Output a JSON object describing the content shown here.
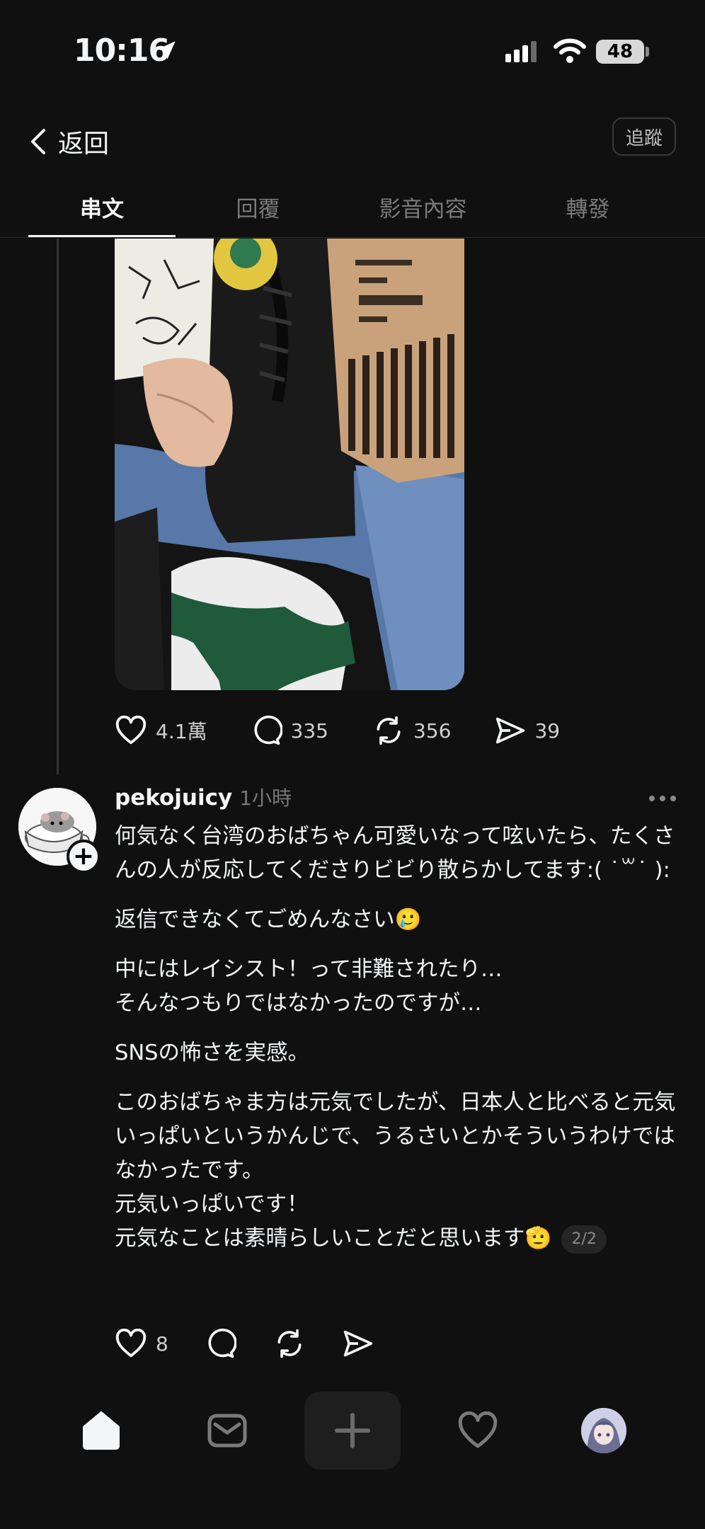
{
  "status_bar": {
    "time": "10:16",
    "battery": "48"
  },
  "header": {
    "back_label": "返回",
    "follow_label": "追蹤"
  },
  "tabs": [
    {
      "label": "串文",
      "active": true
    },
    {
      "label": "回覆"
    },
    {
      "label": "影音內容"
    },
    {
      "label": "轉發"
    }
  ],
  "main_post": {
    "likes": "4.1萬",
    "comments": "335",
    "reposts": "356",
    "shares": "39"
  },
  "reply_post": {
    "username": "pekojuicy",
    "time": "1小時",
    "paragraphs": [
      "何気なく台湾のおばちゃん可愛いなって呟いたら、たくさんの人が反応してくださりビビり散らかしてます:( ˙꒳​˙ ):",
      "返信できなくてごめんなさい🥲",
      "中にはレイシスト！って非難されたり…",
      "そんなつもりではなかったのですが…",
      "SNSの怖さを実感。",
      "このおばちゃま方は元気でしたが、日本人と比べると元気いっぱいというかんじで、うるさいとかそういうわけではなかったです。",
      "元気いっぱいです！",
      "元気なことは素晴らしいことだと思います🫡"
    ],
    "page_indicator": "2/2",
    "likes": "8"
  },
  "icons": {
    "back": "chevron-left-icon",
    "like": "heart-icon",
    "comment": "comment-bubble-icon",
    "repost": "repost-icon",
    "share": "send-icon",
    "home": "home-icon",
    "search": "inbox-icon",
    "compose": "plus-icon",
    "activity": "heart-icon",
    "profile": "profile-avatar"
  },
  "colors": {
    "background": "#101010",
    "text": "#f3f5f7",
    "muted": "#777777"
  }
}
